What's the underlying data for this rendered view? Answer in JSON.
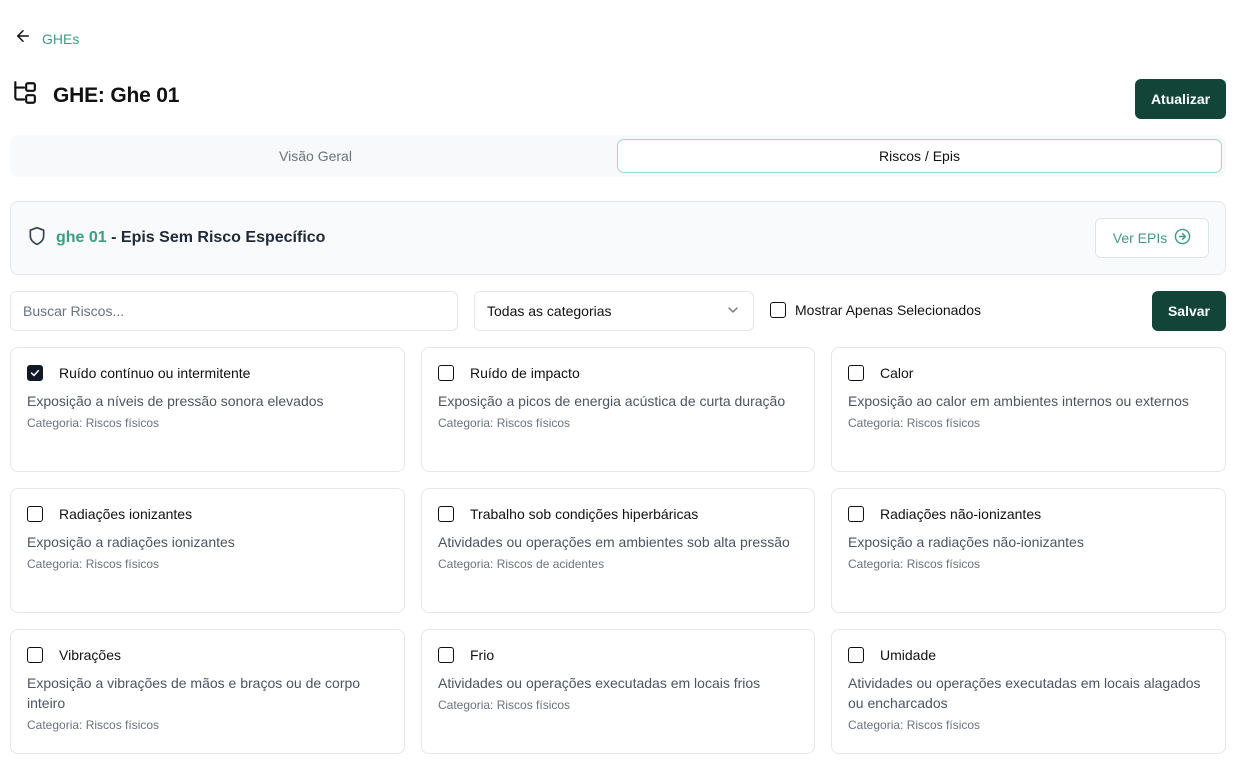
{
  "nav": {
    "back_label": "GHEs"
  },
  "header": {
    "title": "GHE: Ghe 01",
    "update_label": "Atualizar"
  },
  "tabs": [
    {
      "label": "Visão Geral",
      "active": false
    },
    {
      "label": "Riscos / Epis",
      "active": true
    }
  ],
  "epi_section": {
    "name": "ghe 01",
    "suffix": " - Epis Sem Risco Específico",
    "button_label": "Ver EPIs"
  },
  "filters": {
    "search_placeholder": "Buscar Riscos...",
    "category_selected": "Todas as categorias",
    "only_selected_label": "Mostrar Apenas Selecionados",
    "save_label": "Salvar"
  },
  "risks": [
    {
      "title": "Ruído contínuo ou intermitente",
      "description": "Exposição a níveis de pressão sonora elevados",
      "category": "Categoria: Riscos físicos",
      "checked": true
    },
    {
      "title": "Ruído de impacto",
      "description": "Exposição a picos de energia acústica de curta duração",
      "category": "Categoria: Riscos físicos",
      "checked": false
    },
    {
      "title": "Calor",
      "description": "Exposição ao calor em ambientes internos ou externos",
      "category": "Categoria: Riscos físicos",
      "checked": false
    },
    {
      "title": "Radiações ionizantes",
      "description": "Exposição a radiações ionizantes",
      "category": "Categoria: Riscos físicos",
      "checked": false
    },
    {
      "title": "Trabalho sob condições hiperbáricas",
      "description": "Atividades ou operações em ambientes sob alta pressão",
      "category": "Categoria: Riscos de acidentes",
      "checked": false
    },
    {
      "title": "Radiações não-ionizantes",
      "description": "Exposição a radiações não-ionizantes",
      "category": "Categoria: Riscos físicos",
      "checked": false
    },
    {
      "title": "Vibrações",
      "description": "Exposição a vibrações de mãos e braços ou de corpo inteiro",
      "category": "Categoria: Riscos físicos",
      "checked": false
    },
    {
      "title": "Frio",
      "description": "Atividades ou operações executadas em locais frios",
      "category": "Categoria: Riscos físicos",
      "checked": false
    },
    {
      "title": "Umidade",
      "description": "Atividades ou operações executadas em locais alagados ou encharcados",
      "category": "Categoria: Riscos físicos",
      "checked": false
    }
  ],
  "colors": {
    "accent": "#3f9c84",
    "primary_button": "#124438",
    "tab_active_border": "#9fd6c6"
  },
  "icons": {
    "back": "arrow-left-icon",
    "title": "hierarchy-icon",
    "shield": "shield-icon",
    "ver_epis": "arrow-right-circle-icon",
    "select": "chevron-down-icon",
    "check": "check-icon"
  }
}
